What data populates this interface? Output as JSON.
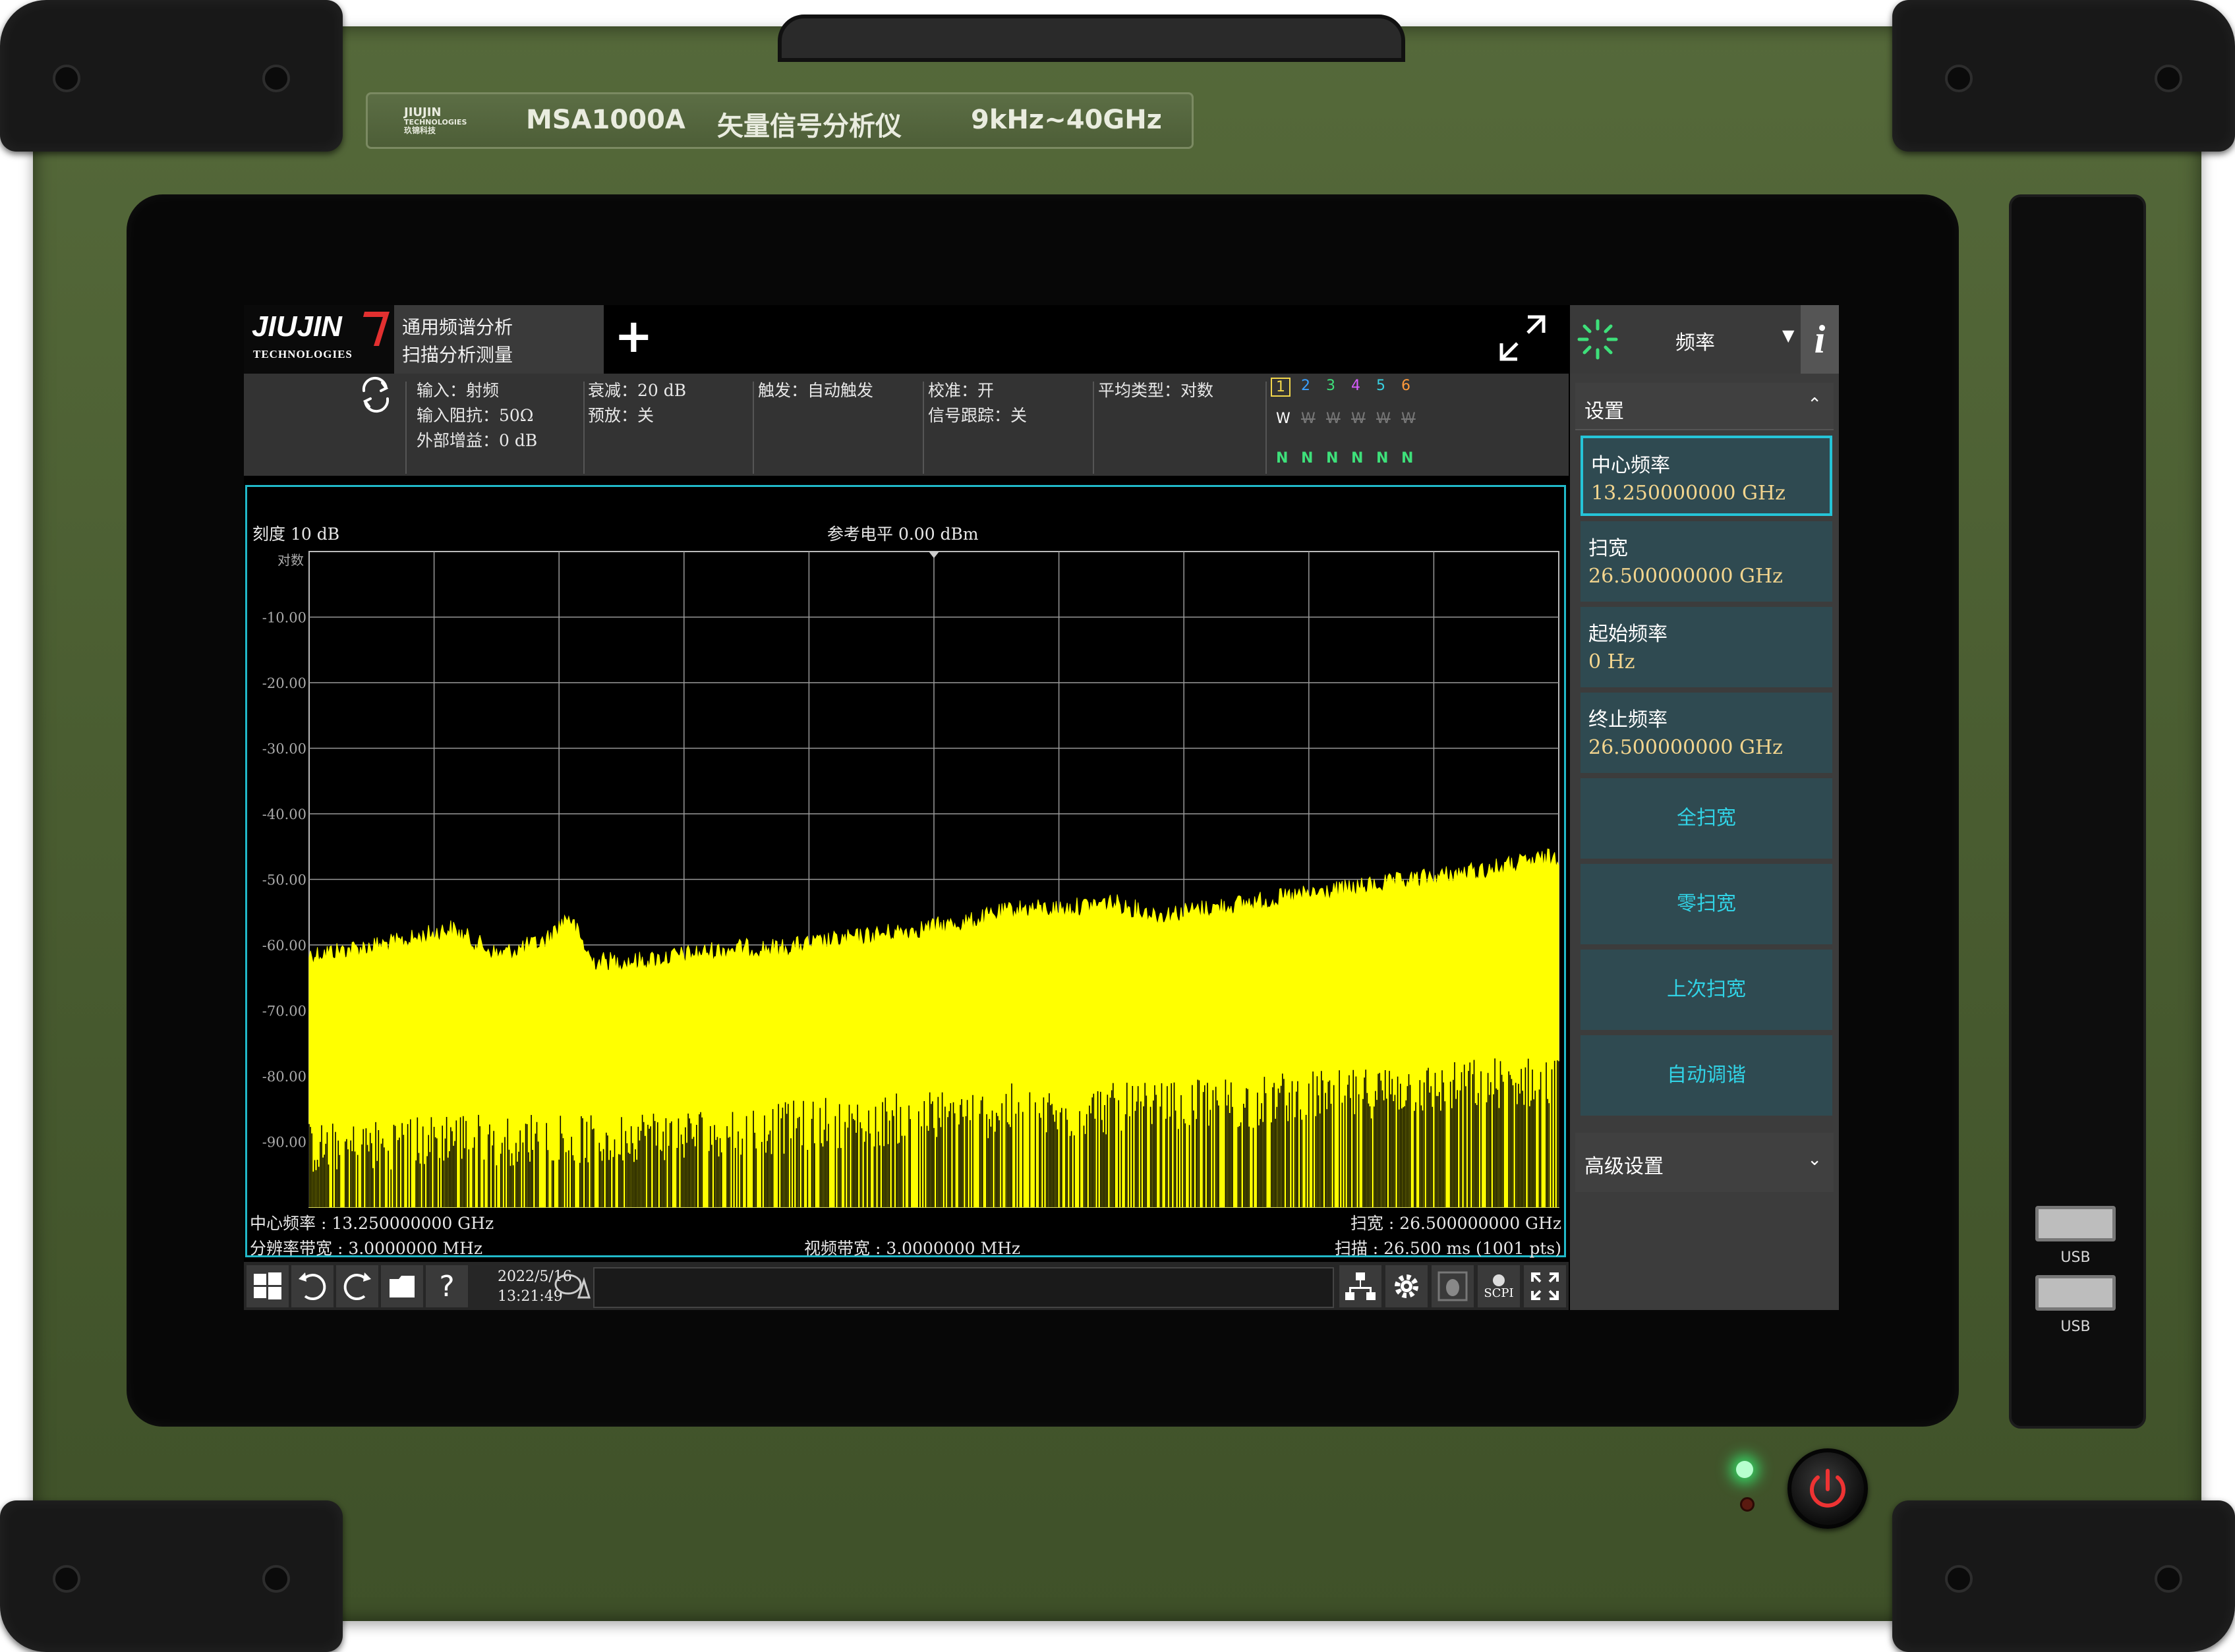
{
  "device": {
    "brand_small": "JIUJIN",
    "brand_sub": "TECHNOLOGIES",
    "brand_cn": "玖锦科技",
    "model": "MSA1000A",
    "title": "矢量信号分析仪",
    "range": "9kHz~40GHz",
    "usb_label_1": "USB",
    "usb_label_2": "USB"
  },
  "app": {
    "logo": "JIUJIN",
    "logo_sub": "TECHNOLOGIES",
    "tab": {
      "line1": "通用频谱分析",
      "line2": "扫描分析测量"
    },
    "add_tab": "+"
  },
  "settings": {
    "input_label": "输入：射频",
    "impedance": "输入阻抗：50Ω",
    "ext_gain": "外部增益：0 dB",
    "atten": "衰减：20 dB",
    "preamp": "预放：关",
    "trigger": "触发：自动触发",
    "calibration": "校准：开",
    "signal_track": "信号跟踪：关",
    "avg_type": "平均类型：对数",
    "traces": [
      {
        "num": "1",
        "color": "#f2d64b",
        "mode": "W",
        "det": "N"
      },
      {
        "num": "2",
        "color": "#3aa0ff",
        "mode": "W",
        "det": "N"
      },
      {
        "num": "3",
        "color": "#3ee07a",
        "mode": "W",
        "det": "N"
      },
      {
        "num": "4",
        "color": "#d85cff",
        "mode": "W",
        "det": "N"
      },
      {
        "num": "5",
        "color": "#39d0e0",
        "mode": "W",
        "det": "N"
      },
      {
        "num": "6",
        "color": "#ff9a3a",
        "mode": "W",
        "det": "N"
      }
    ]
  },
  "graph": {
    "scale": "刻度  10 dB",
    "ref_level": "参考电平  0.00 dBm",
    "log_label": "对数",
    "center_freq": "中心频率 : 13.250000000 GHz",
    "rbw": "分辨率带宽 : 3.0000000 MHz",
    "vbw": "视频带宽 : 3.0000000 MHz",
    "span": "扫宽 : 26.500000000 GHz",
    "sweep": "扫描 : 26.500 ms (1001 pts)"
  },
  "chart_data": {
    "type": "area",
    "y_ticks": [
      "-10.00",
      "-20.00",
      "-30.00",
      "-40.00",
      "-50.00",
      "-60.00",
      "-70.00",
      "-80.00",
      "-90.00"
    ],
    "ylim": [
      -100,
      0
    ],
    "xlim_ghz": [
      0,
      26.5
    ],
    "grid": true,
    "trace_color": "#ffff00",
    "series": [
      {
        "x": [
          0,
          1,
          2,
          2.5,
          3,
          4,
          5,
          5.5,
          6,
          7,
          8,
          9,
          10,
          11,
          12,
          13,
          14,
          15,
          16,
          17,
          18,
          19,
          20,
          21,
          22,
          23,
          24,
          25,
          26.5
        ],
        "peak": [
          -60,
          -59,
          -58,
          -57,
          -56,
          -60,
          -58,
          -54,
          -61,
          -61,
          -60,
          -59,
          -59,
          -58,
          -57,
          -56,
          -55,
          -53,
          -53,
          -52,
          -54,
          -53,
          -52,
          -51,
          -50,
          -49,
          -48,
          -47,
          -45
        ],
        "floor": [
          -95,
          -95,
          -94,
          -94,
          -93,
          -94,
          -93,
          -93,
          -94,
          -93,
          -93,
          -92,
          -92,
          -91,
          -91,
          -90,
          -90,
          -89,
          -90,
          -89,
          -89,
          -88,
          -88,
          -87,
          -87,
          -86,
          -86,
          -85,
          -85
        ]
      }
    ]
  },
  "taskbar": {
    "date": "2022/5/16",
    "time": "13:21:49",
    "scpi": "SCPI"
  },
  "right_panel": {
    "title": "频率",
    "info": "i",
    "section": "设置",
    "params": [
      {
        "name": "中心频率",
        "value": "13.250000000 GHz"
      },
      {
        "name": "扫宽",
        "value": "26.500000000 GHz"
      },
      {
        "name": "起始频率",
        "value": "0  Hz"
      },
      {
        "name": "终止频率",
        "value": "26.500000000 GHz"
      }
    ],
    "actions": [
      "全扫宽",
      "零扫宽",
      "上次扫宽",
      "自动调谐"
    ],
    "advanced": "高级设置"
  }
}
